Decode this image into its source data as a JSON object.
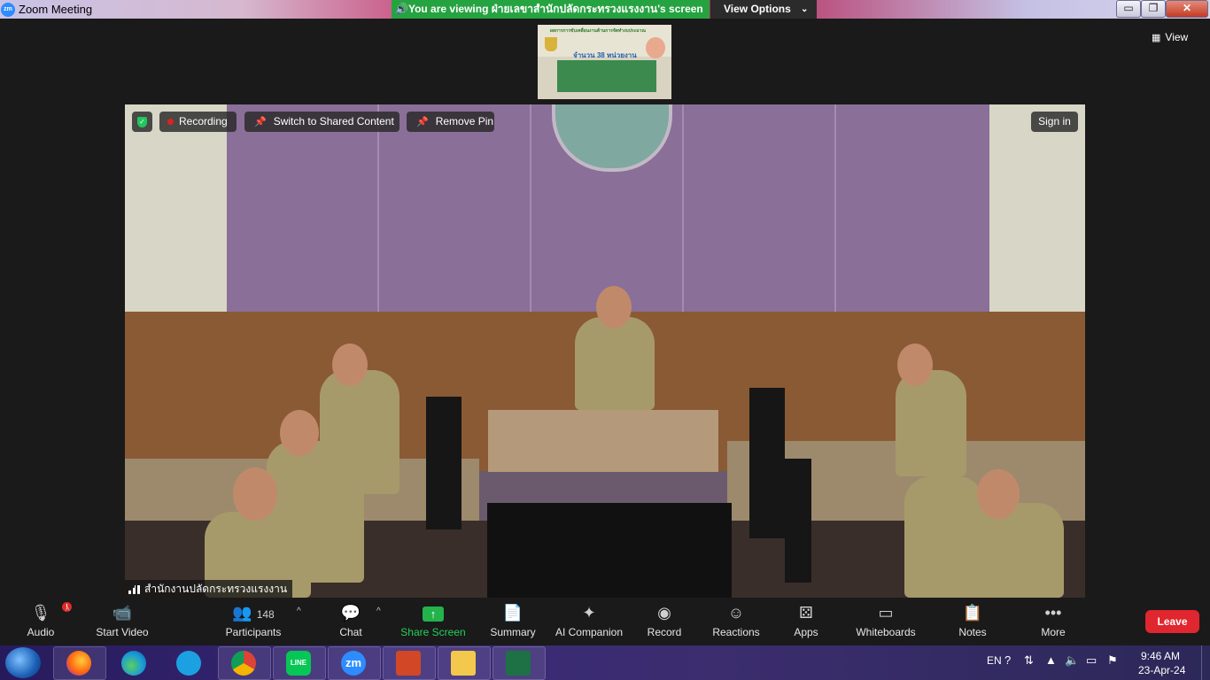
{
  "window": {
    "app_logo": "zm",
    "title": "Zoom Meeting",
    "viewing_banner": "You are viewing ฝ่ายเลขาสำนักปลัดกระทรวงแรงงาน's screen",
    "view_options": "View Options",
    "minimize": "▭",
    "maximize": "❐",
    "close": "✕"
  },
  "top_right": {
    "view_label": "View"
  },
  "thumbnail": {
    "heading": "ผลการการขับเคลื่อนงานด้านการจัดทำงบประมาณ",
    "count": "จำนวน 38 หน่วยงาน"
  },
  "video": {
    "recording_label": "Recording",
    "switch_label": "Switch to Shared Content",
    "remove_pin_label": "Remove Pin",
    "sign_in_label": "Sign in",
    "participant_name": "สำนักงานปลัดกระทรวงแรงงาน"
  },
  "toolbar": {
    "audio": "Audio",
    "audio_alert": "!",
    "start_video": "Start Video",
    "participants": "Participants",
    "participant_count": "148",
    "chat": "Chat",
    "share_screen": "Share Screen",
    "summary": "Summary",
    "ai_companion": "AI Companion",
    "record": "Record",
    "reactions": "Reactions",
    "apps": "Apps",
    "whiteboards": "Whiteboards",
    "notes": "Notes",
    "more": "More",
    "leave": "Leave"
  },
  "taskbar": {
    "apps": [
      "firefox",
      "edge",
      "krungthai",
      "chrome",
      "line",
      "zoom",
      "powerpoint",
      "explorer",
      "excel"
    ],
    "line_label": "LINE",
    "zoom_label": "zm",
    "language": "EN",
    "time": "9:46 AM",
    "date": "23-Apr-24"
  },
  "colors": {
    "banner_green": "#26a341",
    "leave_red": "#e0262e",
    "share_green": "#23b34a",
    "toolbar_bg": "#1a1a1a"
  }
}
